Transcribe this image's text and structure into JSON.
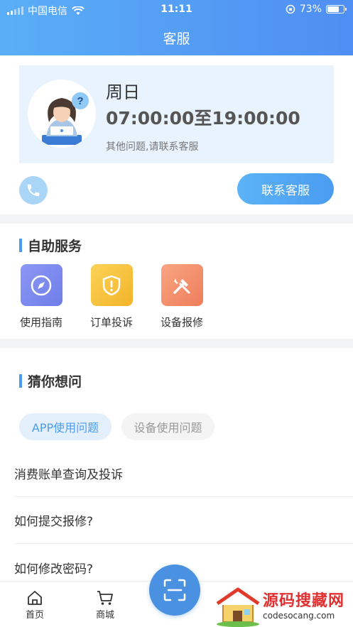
{
  "status_bar": {
    "carrier": "中国电信",
    "time": "11:11",
    "battery": "73%",
    "battery_level": 0.73
  },
  "header": {
    "title": "客服"
  },
  "service_hours": {
    "day": "周日",
    "hours": "07:00:00至19:00:00",
    "note": "其他问题,请联系客服"
  },
  "contact": {
    "button_label": "联系客服"
  },
  "self_service": {
    "title": "自助服务",
    "items": [
      {
        "label": "使用指南",
        "icon": "compass-icon",
        "color": "#7f8cf3"
      },
      {
        "label": "订单投诉",
        "icon": "shield-alert-icon",
        "color": "#f7c43c"
      },
      {
        "label": "设备报修",
        "icon": "tools-icon",
        "color": "#f59572"
      }
    ]
  },
  "guess": {
    "title": "猜你想问",
    "tabs": [
      {
        "label": "APP使用问题",
        "active": true
      },
      {
        "label": "设备使用问题",
        "active": false
      }
    ],
    "questions": [
      "消费账单查询及投诉",
      "如何提交报修?",
      "如何修改密码?"
    ]
  },
  "tabbar": {
    "items": [
      {
        "label": "首页",
        "icon": "home-icon"
      },
      {
        "label": "商城",
        "icon": "cart-icon"
      }
    ],
    "scan_icon": "scan-icon"
  },
  "watermark": {
    "title": "源码搜藏网",
    "url": "codesocang.com"
  },
  "colors": {
    "accent": "#4a9cf0",
    "header_start": "#5aaef7",
    "header_end": "#4f8ef2"
  }
}
